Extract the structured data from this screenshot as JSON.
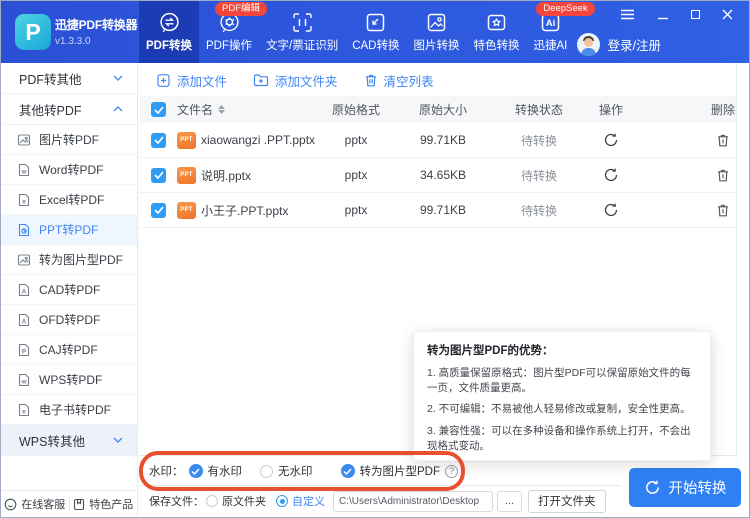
{
  "app": {
    "title": "迅捷PDF转换器",
    "version": "v1.3.3.0",
    "accent_color": "#2f80f3",
    "header_color": "#2b50d6"
  },
  "nav": {
    "tabs": [
      {
        "label": "PDF转换",
        "active": true
      },
      {
        "label": "PDF操作",
        "badge": "PDF编辑"
      },
      {
        "label": "文字/票证识别"
      },
      {
        "label": "CAD转换"
      },
      {
        "label": "图片转换"
      },
      {
        "label": "特色转换"
      },
      {
        "label": "迅捷AI",
        "badge": "DeepSeek"
      }
    ],
    "login_label": "登录/注册"
  },
  "sidebar": {
    "groups": [
      {
        "label": "PDF转其他",
        "expanded": false
      },
      {
        "label": "其他转PDF",
        "expanded": true
      },
      {
        "label": "WPS转其他",
        "expanded": false
      }
    ],
    "items": [
      {
        "label": "图片转PDF"
      },
      {
        "label": "Word转PDF"
      },
      {
        "label": "Excel转PDF"
      },
      {
        "label": "PPT转PDF",
        "selected": true
      },
      {
        "label": "转为图片型PDF"
      },
      {
        "label": "CAD转PDF"
      },
      {
        "label": "OFD转PDF"
      },
      {
        "label": "CAJ转PDF"
      },
      {
        "label": "WPS转PDF"
      },
      {
        "label": "电子书转PDF"
      }
    ],
    "footer": {
      "support": "在线客服",
      "products": "特色产品"
    }
  },
  "toolbar": {
    "add_file": "添加文件",
    "add_folder": "添加文件夹",
    "clear_list": "清空列表"
  },
  "table": {
    "headers": {
      "name": "文件名",
      "format": "原始格式",
      "size": "原始大小",
      "status": "转换状态",
      "action": "操作",
      "delete": "删除"
    },
    "rows": [
      {
        "name": "xiaowangzi .PPT.pptx",
        "format": "pptx",
        "size": "99.71KB",
        "status": "待转换",
        "checked": true
      },
      {
        "name": "说明.pptx",
        "format": "pptx",
        "size": "34.65KB",
        "status": "待转换",
        "checked": true
      },
      {
        "name": "小王子.PPT.pptx",
        "format": "pptx",
        "size": "99.71KB",
        "status": "待转换",
        "checked": true
      }
    ],
    "file_type_label": "PPT"
  },
  "tooltip": {
    "title": "转为图片型PDF的优势：",
    "lines": [
      "1. 高质量保留原格式：图片型PDF可以保留原始文件的每一页，文件质量更高。",
      "2. 不可编辑：不易被他人轻易修改或复制，安全性更高。",
      "3. 兼容性强：可以在多种设备和操作系统上打开，不会出现格式变动。"
    ]
  },
  "watermark": {
    "label": "水印：",
    "with_label": "有水印",
    "without_label": "无水印",
    "image_pdf_label": "转为图片型PDF",
    "with_checked": true,
    "image_pdf_checked": true,
    "annotation_color": "#e8512d"
  },
  "save": {
    "label": "保存文件：",
    "original_label": "原文件夹",
    "custom_label": "自定义",
    "custom_selected": true,
    "path": "C:\\Users\\Administrator\\Desktop",
    "more_label": "...",
    "open_folder_label": "打开文件夹"
  },
  "convert": {
    "start_label": "开始转换"
  }
}
